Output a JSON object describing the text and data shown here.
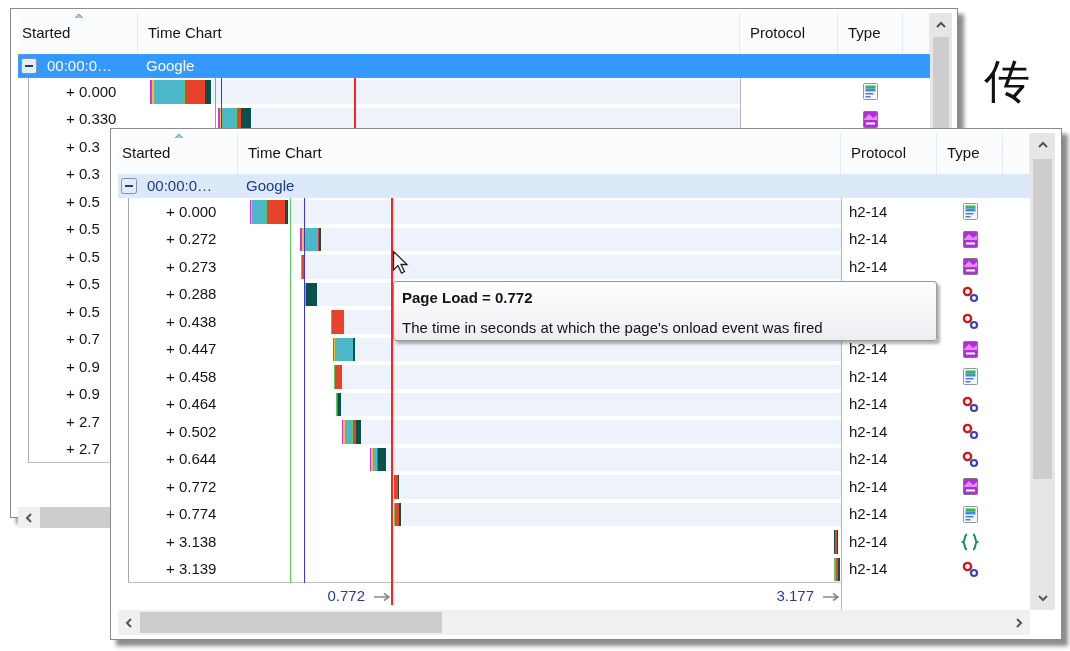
{
  "background_text": "传",
  "windows": [
    {
      "columns": [
        "Started",
        "Time Chart",
        "Protocol",
        "Type"
      ],
      "group": {
        "time": "00:00:0…",
        "host": "Google",
        "selected": true,
        "expanded": true
      },
      "rows": [
        {
          "started": "+ 0.000",
          "kind": "document"
        },
        {
          "started": "+ 0.330",
          "kind": "image"
        },
        {
          "started": "+ 0.3"
        },
        {
          "started": "+ 0.3"
        },
        {
          "started": "+ 0.5"
        },
        {
          "started": "+ 0.5"
        },
        {
          "started": "+ 0.5"
        },
        {
          "started": "+ 0.5"
        },
        {
          "started": "+ 0.5"
        },
        {
          "started": "+ 0.7"
        },
        {
          "started": "+ 0.9"
        },
        {
          "started": "+ 0.9"
        },
        {
          "started": "+ 2.7"
        },
        {
          "started": "+ 2.7"
        }
      ]
    },
    {
      "columns": [
        "Started",
        "Time Chart",
        "Protocol",
        "Type"
      ],
      "group": {
        "time": "00:00:0…",
        "host": "Google",
        "selected": false,
        "expanded": true
      },
      "rows": [
        {
          "started": "+ 0.000",
          "protocol": "h2-14",
          "kind": "document"
        },
        {
          "started": "+ 0.272",
          "protocol": "h2-14",
          "kind": "image"
        },
        {
          "started": "+ 0.273",
          "protocol": "h2-14",
          "kind": "image"
        },
        {
          "started": "+ 0.288",
          "kind": "circles"
        },
        {
          "started": "+ 0.438",
          "kind": "circles"
        },
        {
          "started": "+ 0.447",
          "protocol": "h2-14",
          "kind": "image"
        },
        {
          "started": "+ 0.458",
          "protocol": "h2-14",
          "kind": "document"
        },
        {
          "started": "+ 0.464",
          "protocol": "h2-14",
          "kind": "circles"
        },
        {
          "started": "+ 0.502",
          "protocol": "h2-14",
          "kind": "circles"
        },
        {
          "started": "+ 0.644",
          "protocol": "h2-14",
          "kind": "circles"
        },
        {
          "started": "+ 0.772",
          "protocol": "h2-14",
          "kind": "image"
        },
        {
          "started": "+ 0.774",
          "protocol": "h2-14",
          "kind": "document"
        },
        {
          "started": "+ 3.138",
          "protocol": "h2-14",
          "kind": "braces"
        },
        {
          "started": "+ 3.139",
          "protocol": "h2-14",
          "kind": "circles"
        }
      ],
      "markers": [
        {
          "label": "0.772"
        },
        {
          "label": "3.177"
        }
      ]
    }
  ],
  "tooltip": {
    "title": "Page Load = 0.772",
    "text": "The time in seconds at which the page's onload event was fired"
  }
}
